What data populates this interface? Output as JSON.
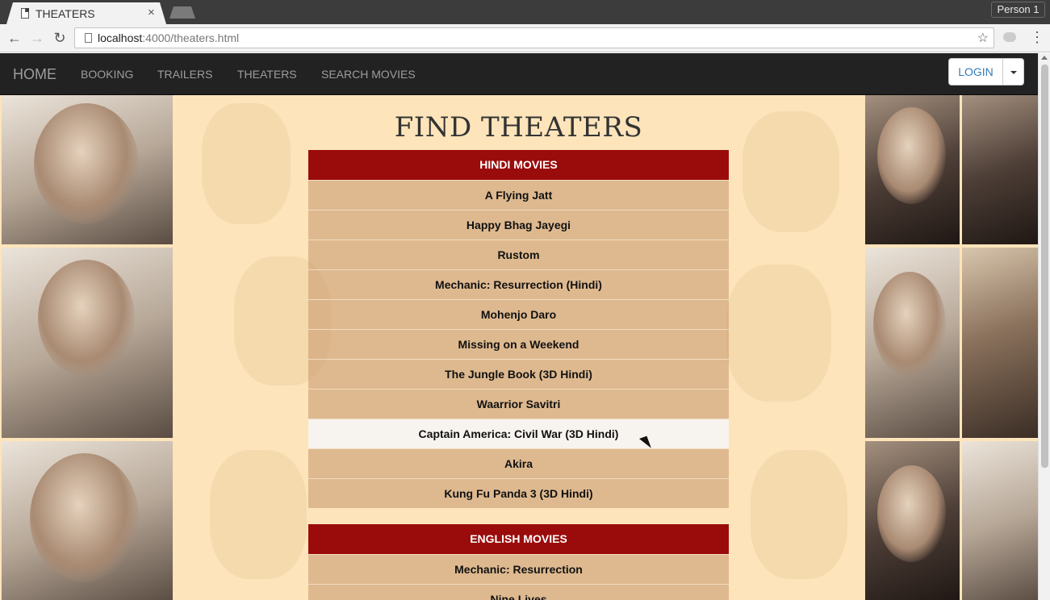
{
  "browser": {
    "tab_title": "THEATERS",
    "tab_close": "×",
    "profile_name": "Person 1",
    "url_host": "localhost",
    "url_path": ":4000/theaters.html",
    "back_glyph": "←",
    "forward_glyph": "→",
    "reload_glyph": "↻",
    "star_glyph": "☆",
    "menu_glyph": "⋮"
  },
  "navbar": {
    "brand": "HOME",
    "links": [
      "BOOKING",
      "TRAILERS",
      "THEATERS",
      "SEARCH MOVIES"
    ],
    "login_label": "LOGIN"
  },
  "page": {
    "title": "FIND THEATERS",
    "sections": [
      {
        "header": "HINDI MOVIES",
        "movies": [
          "A Flying Jatt",
          "Happy Bhag Jayegi",
          "Rustom",
          "Mechanic: Resurrection (Hindi)",
          "Mohenjo Daro",
          "Missing on a Weekend",
          "The Jungle Book (3D Hindi)",
          "Waarrior Savitri",
          "Captain America: Civil War (3D Hindi)",
          "Akira",
          "Kung Fu Panda 3 (3D Hindi)"
        ]
      },
      {
        "header": "ENGLISH MOVIES",
        "movies": [
          "Mechanic: Resurrection",
          "Nine Lives"
        ]
      }
    ]
  },
  "colors": {
    "section_header": "#9a0b0b",
    "navbar": "#222222",
    "page_background": "#fde4ba",
    "login_text": "#337ab7"
  }
}
